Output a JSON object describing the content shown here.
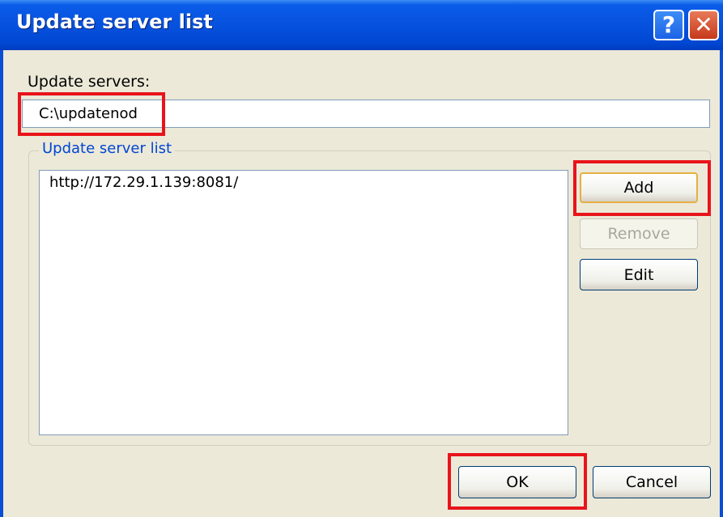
{
  "window": {
    "title": "Update server list",
    "help_glyph": "?",
    "close_glyph": "✕"
  },
  "servers": {
    "label": "Update servers:",
    "value": "C:\\updatenod"
  },
  "group": {
    "title": "Update server list",
    "items": [
      "http://172.29.1.139:8081/"
    ]
  },
  "buttons": {
    "add": "Add",
    "remove": "Remove",
    "edit": "Edit",
    "ok": "OK",
    "cancel": "Cancel"
  },
  "colors": {
    "title_bar": "#0753e0",
    "highlight": "#e8141c",
    "group_title": "#0046d5"
  }
}
